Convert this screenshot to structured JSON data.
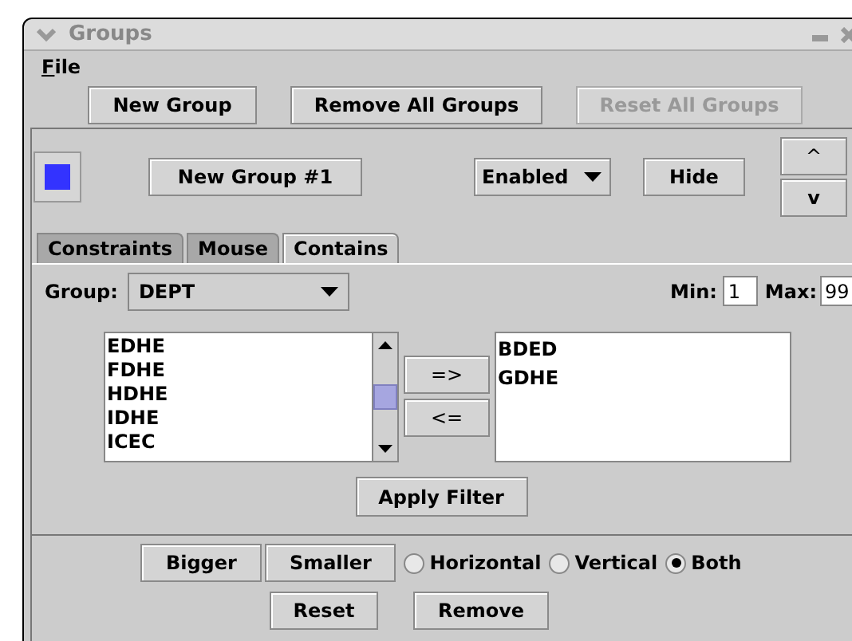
{
  "window": {
    "title": "Groups"
  },
  "menu": [
    {
      "label": "File"
    }
  ],
  "toolbar": [
    {
      "label": "New Group",
      "disabled": false
    },
    {
      "label": "Remove All Groups",
      "disabled": false
    },
    {
      "label": "Reset All Groups",
      "disabled": true
    }
  ],
  "group": {
    "color": "#3333ff",
    "name": "New Group #1",
    "status": "Enabled",
    "hide": "Hide",
    "up": "^",
    "down": "v"
  },
  "tabs": [
    {
      "label": "Constraints",
      "selected": false
    },
    {
      "label": "Mouse",
      "selected": false
    },
    {
      "label": "Contains",
      "selected": true
    }
  ],
  "filter": {
    "group_label": "Group:",
    "group_value": "DEPT",
    "min_label": "Min:",
    "min": "1",
    "max_label": "Max:",
    "max": "99",
    "available": [
      "EDHE",
      "FDHE",
      "HDHE",
      "IDHE",
      "ICEC"
    ],
    "move_right": "=>",
    "move_left": "<=",
    "contained": [
      "BDED",
      "GDHE"
    ],
    "apply": "Apply Filter"
  },
  "size_buttons": [
    "Bigger",
    "Smaller"
  ],
  "orientation": [
    {
      "label": "Horizontal",
      "selected": false
    },
    {
      "label": "Vertical",
      "selected": false
    },
    {
      "label": "Both",
      "selected": true
    }
  ],
  "actions": [
    "Reset",
    "Remove"
  ]
}
